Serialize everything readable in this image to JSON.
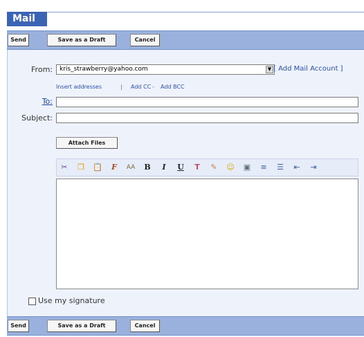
{
  "title": "Mail",
  "toolbar": {
    "send": "Send",
    "draft": "Save as a Draft",
    "cancel": "Cancel"
  },
  "form": {
    "from_label": "From:",
    "from_value": "kris_strawberry@yahoo.com",
    "add_account": "[ Add Mail Account ]",
    "insert_addresses": "Insert addresses",
    "separator": "|",
    "add_cc": "Add CC",
    "cc_sep": "-",
    "add_bcc": "Add BCC",
    "to_label": "To:",
    "subject_label": "Subject:",
    "attach": "Attach Files"
  },
  "editor_icons": [
    "cut-icon",
    "copy-icon",
    "paste-icon",
    "font-icon",
    "font-size-icon",
    "bold-icon",
    "italic-icon",
    "underline-icon",
    "text-color-icon",
    "highlight-icon",
    "emoticon-icon",
    "image-icon",
    "align-icon",
    "list-icon",
    "outdent-icon",
    "indent-icon"
  ],
  "signature_label": "Use my signature"
}
